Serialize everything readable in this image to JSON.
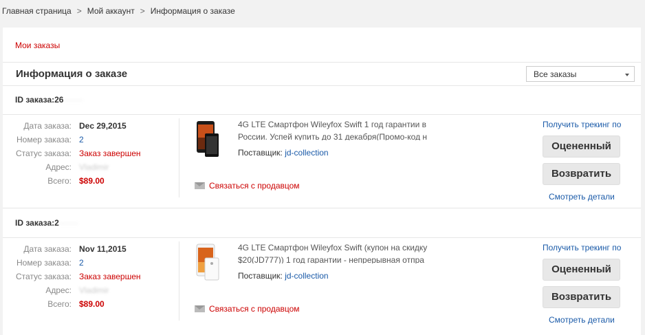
{
  "breadcrumb": [
    "Главная страница",
    "Мой аккаунт",
    "Информация о заказе"
  ],
  "breadcrumb_separator": ">",
  "my_orders": "Мои заказы",
  "page_title": "Информация о заказе",
  "filter": {
    "selected": "Все заказы"
  },
  "labels": {
    "date": "Дата заказа:",
    "number": "Номер заказа:",
    "status": "Статус заказа:",
    "address": "Адрес:",
    "total": "Всего:",
    "supplier": "Поставщик:",
    "contact": "Связаться с продавцом",
    "tracking": "Получить трекинг по",
    "rated": "Оцененный",
    "return": "Возвратить",
    "details": "Смотреть детали"
  },
  "orders": [
    {
      "id_label": "ID заказа:",
      "id_prefix": "26",
      "date": "Dec 29,2015",
      "number": "2",
      "status": "Заказ завершен",
      "address": "Vladimir",
      "total": "$89.00",
      "description": "4G LTE Смартфон Wileyfox Swift 1 год гарантии в России. Успей купить до 31 декабря(Промо-код н",
      "supplier": "jd-collection"
    },
    {
      "id_label": "ID заказа:",
      "id_prefix": "2",
      "date": "Nov 11,2015",
      "number": "2",
      "status": "Заказ завершен",
      "address": "Vladimir",
      "total": "$89.00",
      "description": "4G LTE Смартфон Wileyfox Swift (купон на скидку $20(JD777)) 1 год гарантии - непрерывная отпра",
      "supplier": "jd-collection"
    }
  ]
}
